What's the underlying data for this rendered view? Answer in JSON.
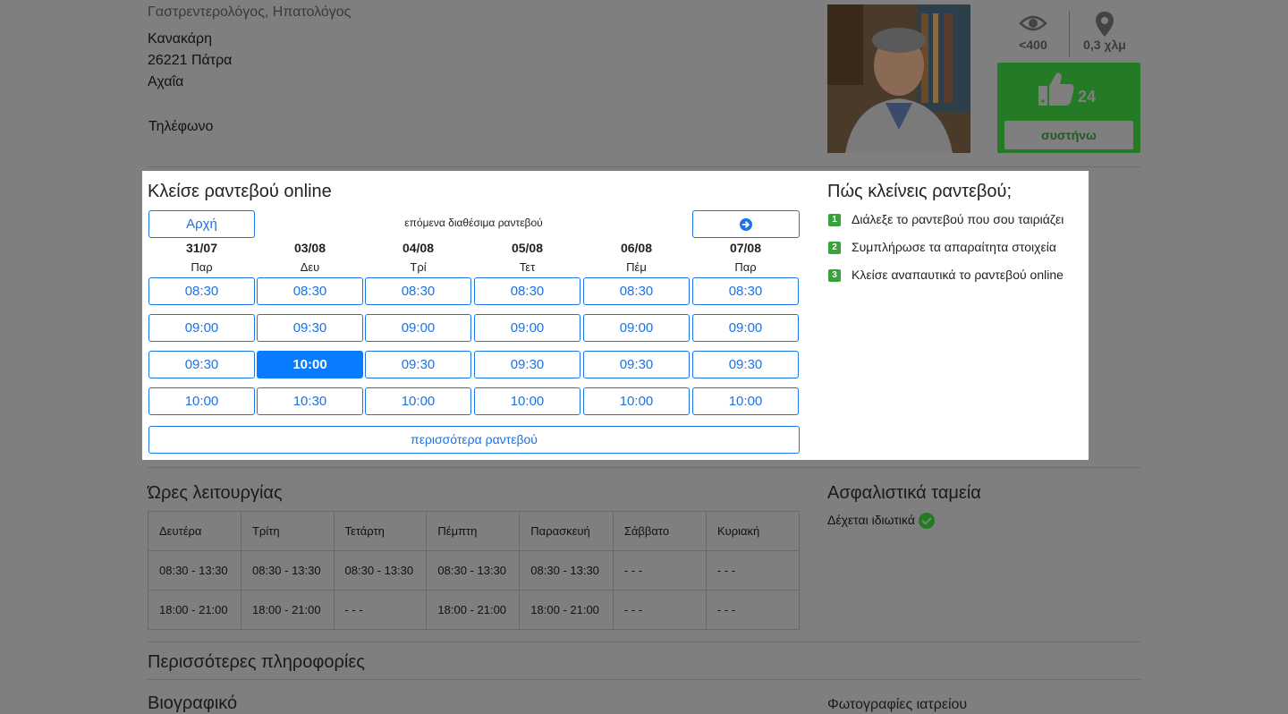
{
  "doctor": {
    "specialty": "Γαστρεντερολόγος, Ηπατολόγος",
    "address_line1": "Κανακάρη",
    "address_line2": "26221 Πάτρα",
    "address_line3": "Αχαΐα",
    "phone_label": "Τηλέφωνο"
  },
  "stats": {
    "views": "<400",
    "distance": "0,3 χλμ",
    "recommend_count": "24",
    "recommend_label": "συστήνω"
  },
  "booking": {
    "title": "Κλείσε ραντεβού online",
    "start_button": "Αρχή",
    "next_label": "επόμενα διαθέσιμα ραντεβού",
    "more_button": "περισσότερα ραντεβού",
    "days": [
      {
        "date": "31/07",
        "day": "Παρ",
        "slots": [
          "08:30",
          "09:00",
          "09:30",
          "10:00"
        ]
      },
      {
        "date": "03/08",
        "day": "Δευ",
        "slots": [
          "08:30",
          "09:30",
          "10:00",
          "10:30"
        ]
      },
      {
        "date": "04/08",
        "day": "Τρί",
        "slots": [
          "08:30",
          "09:00",
          "09:30",
          "10:00"
        ]
      },
      {
        "date": "05/08",
        "day": "Τετ",
        "slots": [
          "08:30",
          "09:00",
          "09:30",
          "10:00"
        ]
      },
      {
        "date": "06/08",
        "day": "Πέμ",
        "slots": [
          "08:30",
          "09:00",
          "09:30",
          "10:00"
        ]
      },
      {
        "date": "07/08",
        "day": "Παρ",
        "slots": [
          "08:30",
          "09:00",
          "09:30",
          "10:00"
        ]
      }
    ],
    "selected_slot": "10:00",
    "how_title": "Πώς κλείνεις ραντεβού;",
    "steps": [
      "Διάλεξε το ραντεβού που σου ταιριάζει",
      "Συμπλήρωσε τα απαραίτητα στοιχεία",
      "Κλείσε αναπαυτικά το ραντεβού online"
    ]
  },
  "hours": {
    "title": "Ώρες λειτουργίας",
    "days": [
      "Δευτέρα",
      "Τρίτη",
      "Τετάρτη",
      "Πέμπτη",
      "Παρασκευή",
      "Σάββατο",
      "Κυριακή"
    ],
    "row1": [
      "08:30 - 13:30",
      "08:30 - 13:30",
      "08:30 - 13:30",
      "08:30 - 13:30",
      "08:30 - 13:30",
      "- - -",
      "- - -"
    ],
    "row2": [
      "18:00 - 21:00",
      "18:00 - 21:00",
      "- - -",
      "18:00 - 21:00",
      "18:00 - 21:00",
      "- - -",
      "- - -"
    ]
  },
  "insurance": {
    "title": "Ασφαλιστικά ταμεία",
    "text": "Δέχεται ιδιωτικά"
  },
  "more_info": {
    "title": "Περισσότερες πληροφορίες"
  },
  "bio": {
    "title": "Βιογραφικό"
  },
  "photos": {
    "title": "Φωτογραφίες ιατρείου"
  }
}
